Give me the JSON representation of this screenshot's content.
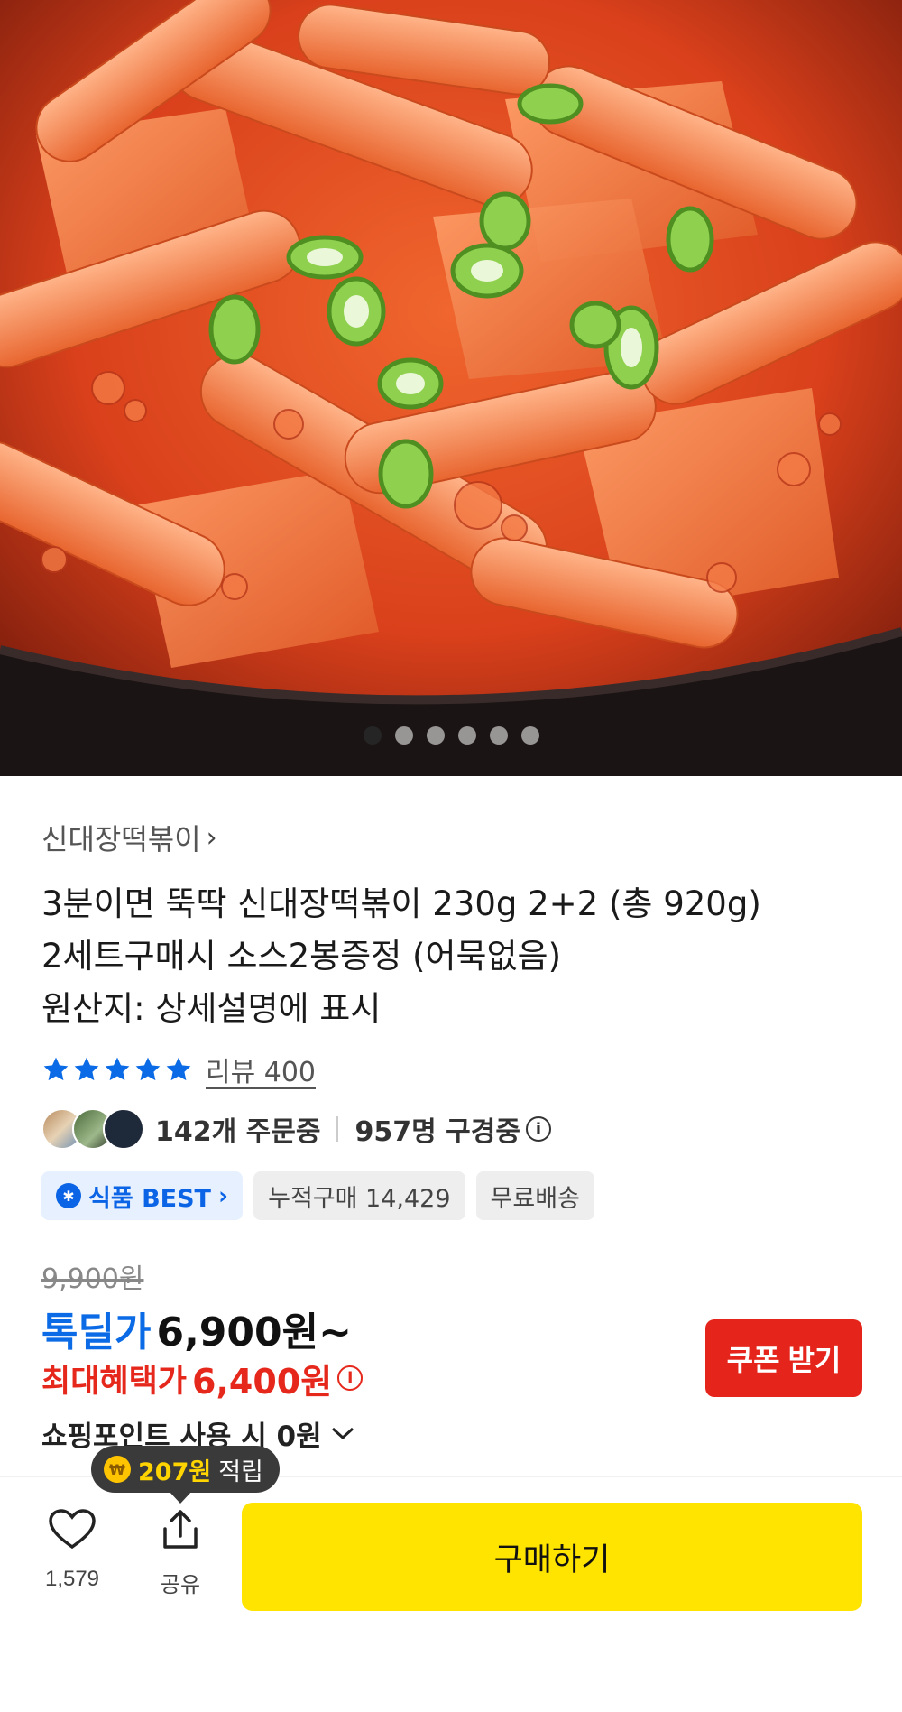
{
  "hero": {
    "slide_count": 6,
    "active_index": 0
  },
  "product": {
    "store": "신대장떡볶이",
    "title_lines": [
      "3분이면 뚝딱 신대장떡볶이 230g 2+2 (총 920g)",
      "2세트구매시 소스2봉증정 (어묵없음)",
      "원산지: 상세설명에 표시"
    ],
    "rating_stars": 5,
    "review_label": "리뷰 400",
    "orders": "142개 주문중",
    "viewers": "957명 구경중",
    "badges": {
      "best": "식품 BEST",
      "cumulative": "누적구매 14,429",
      "shipping": "무료배송"
    }
  },
  "price": {
    "original": "9,900원",
    "sale_label": "톡딜가",
    "sale_price": "6,900원~",
    "max_label": "최대혜택가",
    "max_price": "6,400원",
    "coupon_button": "쿠폰 받기",
    "point_use": "쇼핑포인트 사용 시 0원"
  },
  "bottom_bar": {
    "tooltip_amount": "207원",
    "tooltip_suffix": "적립",
    "like_count": "1,579",
    "share_label": "공유",
    "buy_label": "구매하기"
  },
  "colors": {
    "accent_blue": "#0b6ae5",
    "accent_red": "#e5281b",
    "buy_yellow": "#ffe400"
  },
  "icons": [
    "chevron-right-icon",
    "star-icon",
    "info-icon",
    "chevron-down-icon",
    "heart-icon",
    "share-icon",
    "coin-icon",
    "gear-badge-icon"
  ]
}
